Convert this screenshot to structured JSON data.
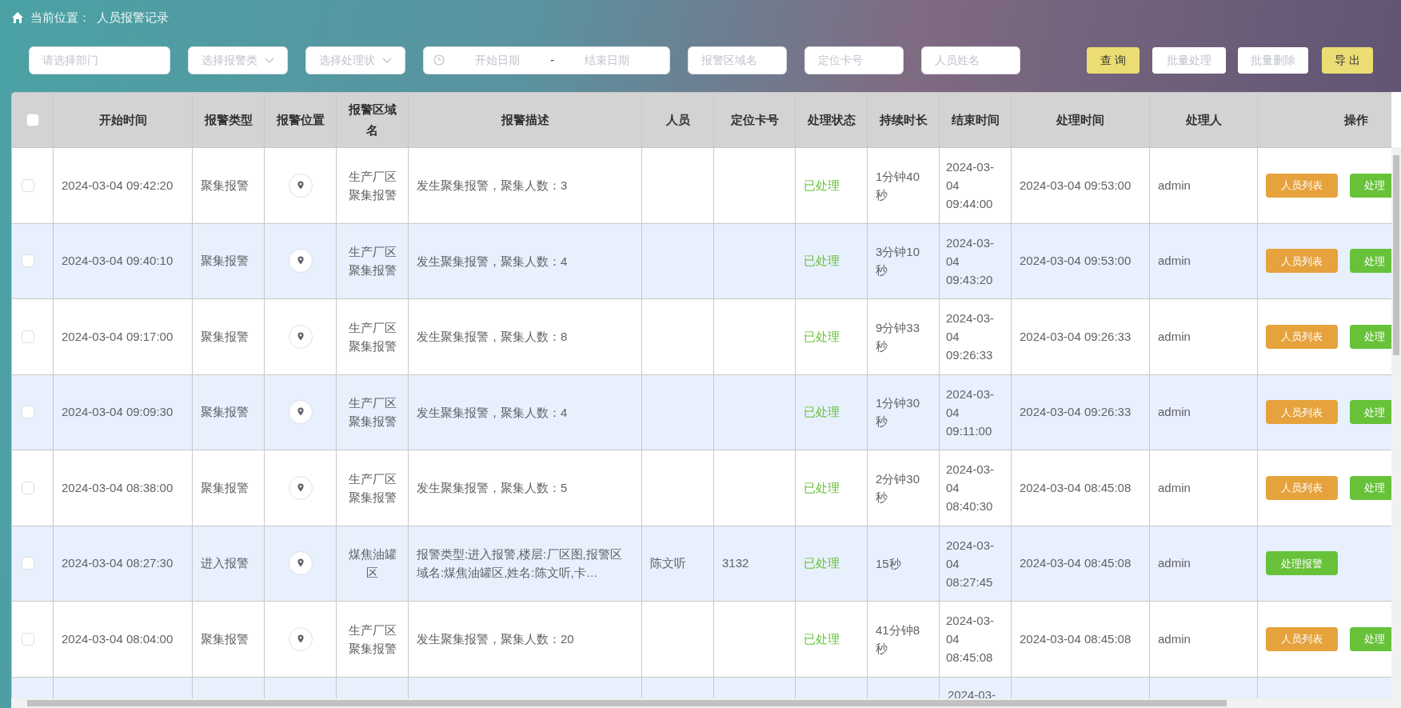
{
  "breadcrumb": {
    "label": "当前位置：",
    "page": "人员报警记录"
  },
  "filters": [
    {
      "kind": "input",
      "placeholder": "请选择部门"
    },
    {
      "kind": "select",
      "placeholder": "选择报警类"
    },
    {
      "kind": "select",
      "placeholder": "选择处理状"
    },
    {
      "kind": "daterange",
      "start_placeholder": "开始日期",
      "separator": "-",
      "end_placeholder": "结束日期"
    },
    {
      "kind": "input",
      "placeholder": "报警区域名"
    },
    {
      "kind": "input",
      "placeholder": "定位卡号"
    },
    {
      "kind": "input",
      "placeholder": "人员姓名"
    }
  ],
  "buttons": [
    {
      "label": "查 询",
      "kind": "primary"
    },
    {
      "label": "批量处理",
      "kind": "plain"
    },
    {
      "label": "批量删除",
      "kind": "plain"
    },
    {
      "label": "导 出",
      "kind": "primary"
    }
  ],
  "table": {
    "select_all": {
      "checked": false
    },
    "columns": [
      "开始时间",
      "报警类型",
      "报警位置",
      "报警区域名",
      "报警描述",
      "人员",
      "定位卡号",
      "处理状态",
      "持续时长",
      "结束时间",
      "处理时间",
      "处理人",
      "操作"
    ],
    "rows": [
      {
        "selected": false,
        "start_time": "2024-03-04 09:42:20",
        "type": "聚集报警",
        "area": "生产厂区聚集报警",
        "description": "发生聚集报警，聚集人数：3",
        "person": "",
        "card": "",
        "status": {
          "text": "已处理",
          "kind": "done"
        },
        "duration": "1分钟40秒",
        "end_time": "2024-03-04 09:44:00",
        "handle_time": "2024-03-04 09:53:00",
        "handler": "admin",
        "actions": [
          {
            "label": "人员列表",
            "kind": "warning"
          },
          {
            "label": "处理",
            "kind": "success"
          }
        ]
      },
      {
        "selected": false,
        "start_time": "2024-03-04 09:40:10",
        "type": "聚集报警",
        "area": "生产厂区聚集报警",
        "description": "发生聚集报警，聚集人数：4",
        "person": "",
        "card": "",
        "status": {
          "text": "已处理",
          "kind": "done"
        },
        "duration": "3分钟10秒",
        "end_time": "2024-03-04 09:43:20",
        "handle_time": "2024-03-04 09:53:00",
        "handler": "admin",
        "actions": [
          {
            "label": "人员列表",
            "kind": "warning"
          },
          {
            "label": "处理",
            "kind": "success"
          }
        ]
      },
      {
        "selected": false,
        "start_time": "2024-03-04 09:17:00",
        "type": "聚集报警",
        "area": "生产厂区聚集报警",
        "description": "发生聚集报警，聚集人数：8",
        "person": "",
        "card": "",
        "status": {
          "text": "已处理",
          "kind": "done"
        },
        "duration": "9分钟33秒",
        "end_time": "2024-03-04 09:26:33",
        "handle_time": "2024-03-04 09:26:33",
        "handler": "admin",
        "actions": [
          {
            "label": "人员列表",
            "kind": "warning"
          },
          {
            "label": "处理",
            "kind": "success"
          }
        ]
      },
      {
        "selected": false,
        "start_time": "2024-03-04 09:09:30",
        "type": "聚集报警",
        "area": "生产厂区聚集报警",
        "description": "发生聚集报警，聚集人数：4",
        "person": "",
        "card": "",
        "status": {
          "text": "已处理",
          "kind": "done"
        },
        "duration": "1分钟30秒",
        "end_time": "2024-03-04 09:11:00",
        "handle_time": "2024-03-04 09:26:33",
        "handler": "admin",
        "actions": [
          {
            "label": "人员列表",
            "kind": "warning"
          },
          {
            "label": "处理",
            "kind": "success"
          }
        ]
      },
      {
        "selected": false,
        "start_time": "2024-03-04 08:38:00",
        "type": "聚集报警",
        "area": "生产厂区聚集报警",
        "description": "发生聚集报警，聚集人数：5",
        "person": "",
        "card": "",
        "status": {
          "text": "已处理",
          "kind": "done"
        },
        "duration": "2分钟30秒",
        "end_time": "2024-03-04 08:40:30",
        "handle_time": "2024-03-04 08:45:08",
        "handler": "admin",
        "actions": [
          {
            "label": "人员列表",
            "kind": "warning"
          },
          {
            "label": "处理",
            "kind": "success"
          }
        ]
      },
      {
        "selected": false,
        "start_time": "2024-03-04 08:27:30",
        "type": "进入报警",
        "area": "煤焦油罐区",
        "description": "报警类型:进入报警,楼层:厂区图,报警区域名:煤焦油罐区,姓名:陈文听,卡…",
        "person": "陈文听",
        "card": "3132",
        "status": {
          "text": "已处理",
          "kind": "done"
        },
        "duration": "15秒",
        "end_time": "2024-03-04 08:27:45",
        "handle_time": "2024-03-04 08:45:08",
        "handler": "admin",
        "actions": [
          {
            "label": "处理报警",
            "kind": "success"
          }
        ]
      },
      {
        "selected": false,
        "start_time": "2024-03-04 08:04:00",
        "type": "聚集报警",
        "area": "生产厂区聚集报警",
        "description": "发生聚集报警，聚集人数：20",
        "person": "",
        "card": "",
        "status": {
          "text": "已处理",
          "kind": "done"
        },
        "duration": "41分钟8秒",
        "end_time": "2024-03-04 08:45:08",
        "handle_time": "2024-03-04 08:45:08",
        "handler": "admin",
        "actions": [
          {
            "label": "人员列表",
            "kind": "warning"
          },
          {
            "label": "处理",
            "kind": "success"
          }
        ]
      },
      {
        "end_time": "2024-03-"
      }
    ]
  }
}
